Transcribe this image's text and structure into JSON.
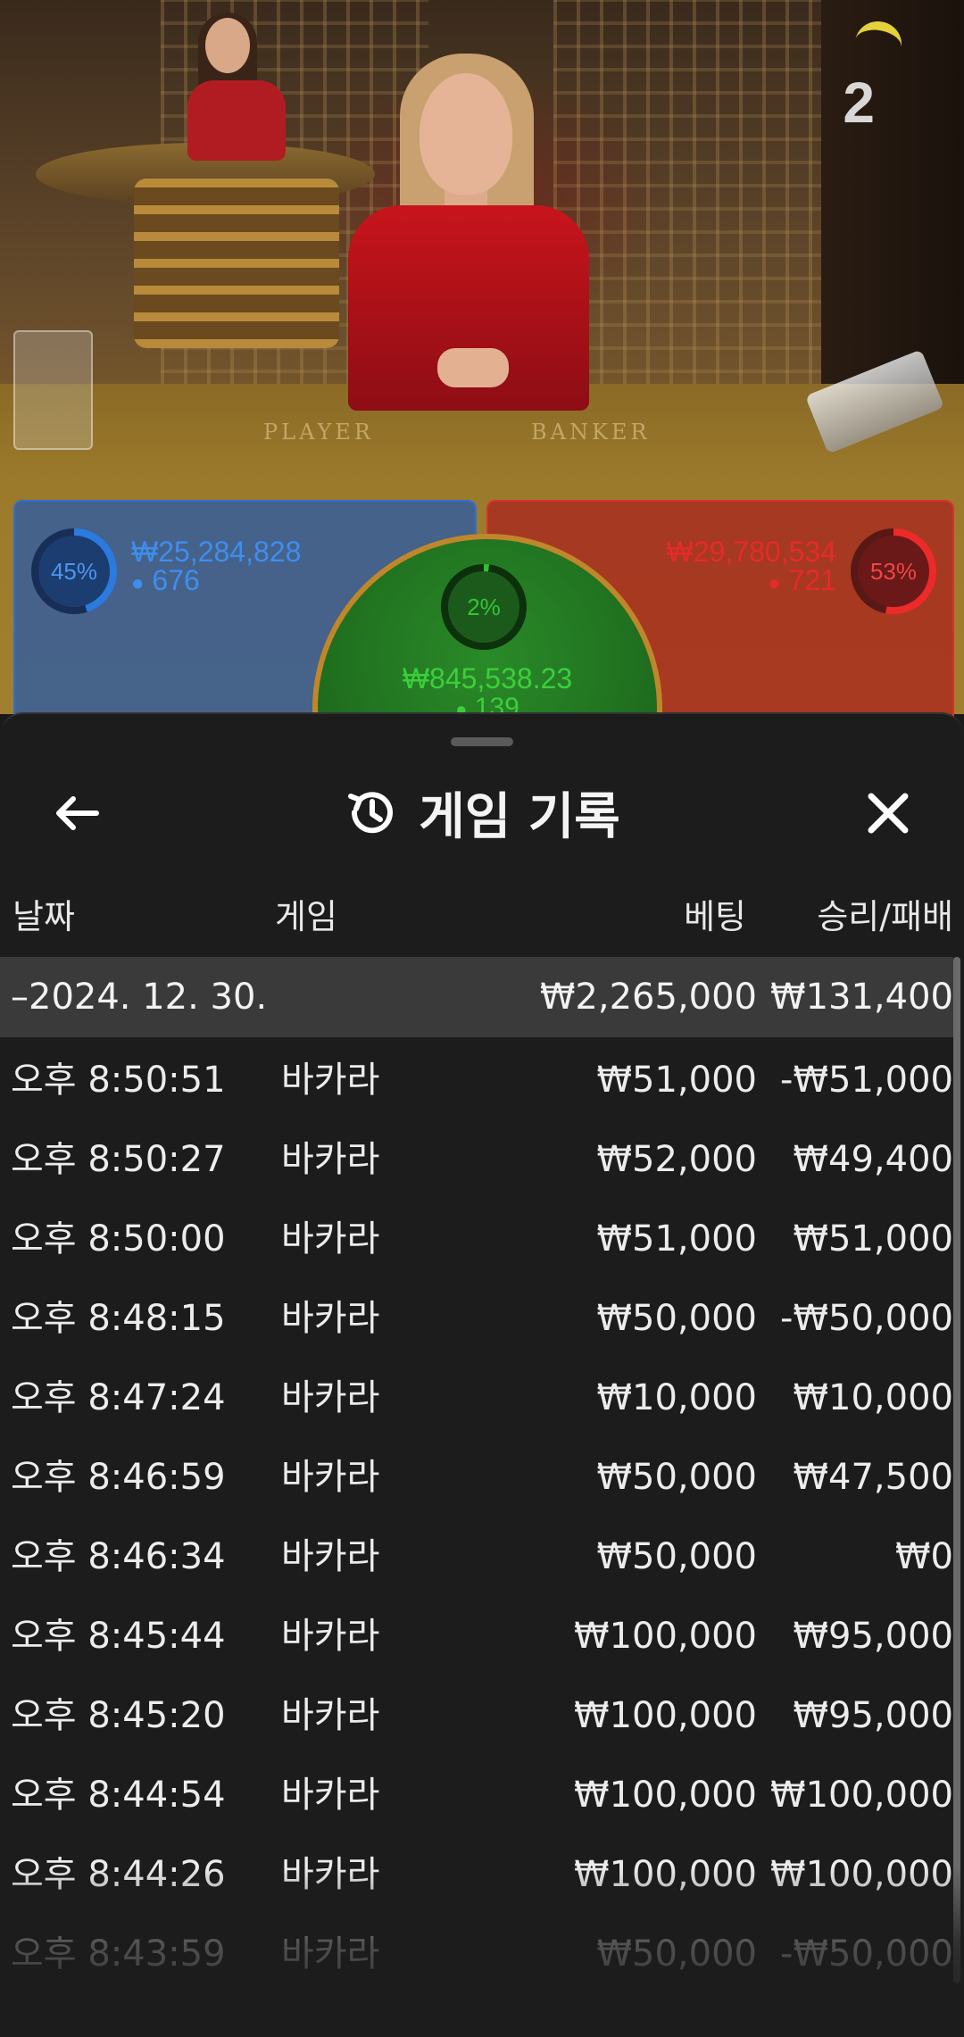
{
  "video": {
    "round_count": "2",
    "table_labels": {
      "player": "PLAYER",
      "banker": "BANKER"
    }
  },
  "bets": {
    "player": {
      "percent": "45%",
      "amount": "₩25,284,828",
      "users": "676",
      "color": "#2f6fd0"
    },
    "banker": {
      "percent": "53%",
      "amount": "₩29,780,534",
      "users": "721",
      "color": "#d83030"
    },
    "tie": {
      "percent": "2%",
      "amount": "₩845,538.23",
      "users": "139",
      "color": "#2a8a28"
    }
  },
  "sheet": {
    "title": "게임 기록",
    "icons": {
      "back": "arrow-left-icon",
      "history": "history-icon",
      "close": "close-icon",
      "user": "user-icon"
    },
    "columns": {
      "date": "날짜",
      "game": "게임",
      "bet": "베팅",
      "win_loss": "승리/패배"
    },
    "summary": {
      "date": "–2024. 12. 30.",
      "bet": "₩2,265,000",
      "win_loss": "₩131,400"
    },
    "rows": [
      {
        "time": "오후 8:50:51",
        "game": "바카라",
        "bet": "₩51,000",
        "win_loss": "-₩51,000"
      },
      {
        "time": "오후 8:50:27",
        "game": "바카라",
        "bet": "₩52,000",
        "win_loss": "₩49,400"
      },
      {
        "time": "오후 8:50:00",
        "game": "바카라",
        "bet": "₩51,000",
        "win_loss": "₩51,000"
      },
      {
        "time": "오후 8:48:15",
        "game": "바카라",
        "bet": "₩50,000",
        "win_loss": "-₩50,000"
      },
      {
        "time": "오후 8:47:24",
        "game": "바카라",
        "bet": "₩10,000",
        "win_loss": "₩10,000"
      },
      {
        "time": "오후 8:46:59",
        "game": "바카라",
        "bet": "₩50,000",
        "win_loss": "₩47,500"
      },
      {
        "time": "오후 8:46:34",
        "game": "바카라",
        "bet": "₩50,000",
        "win_loss": "₩0"
      },
      {
        "time": "오후 8:45:44",
        "game": "바카라",
        "bet": "₩100,000",
        "win_loss": "₩95,000"
      },
      {
        "time": "오후 8:45:20",
        "game": "바카라",
        "bet": "₩100,000",
        "win_loss": "₩95,000"
      },
      {
        "time": "오후 8:44:54",
        "game": "바카라",
        "bet": "₩100,000",
        "win_loss": "₩100,000"
      },
      {
        "time": "오후 8:44:26",
        "game": "바카라",
        "bet": "₩100,000",
        "win_loss": "₩100,000"
      },
      {
        "time": "오후 8:43:59",
        "game": "바카라",
        "bet": "₩50,000",
        "win_loss": "-₩50,000"
      }
    ]
  }
}
